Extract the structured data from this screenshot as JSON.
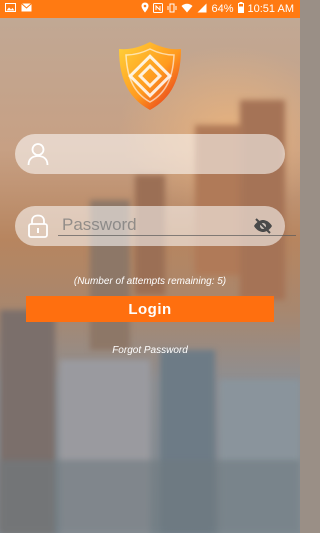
{
  "status_bar": {
    "battery_percent": "64%",
    "time": "10:51 AM",
    "background_color": "#ff7a12",
    "icons": [
      "image-icon",
      "mail-icon",
      "location-icon",
      "nfc-icon",
      "vibrate-icon",
      "wifi-icon",
      "signal-icon",
      "battery-icon"
    ]
  },
  "logo": {
    "icon": "shield-logo-icon"
  },
  "username": {
    "value": "",
    "placeholder": "",
    "icon": "user-icon"
  },
  "password": {
    "value": "",
    "placeholder": "Password",
    "icon": "lock-icon",
    "toggle_icon": "eye-off-icon"
  },
  "attempts_text": "(Number of attempts remaining: 5)",
  "login_label": "Login",
  "login_color": "#ff6f0f",
  "forgot_label": "Forgot Password"
}
